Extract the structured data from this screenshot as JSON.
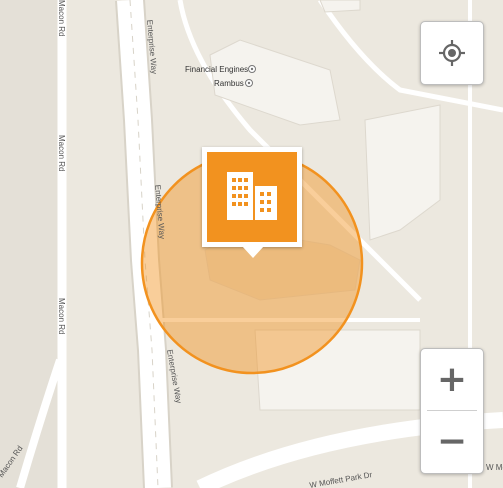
{
  "map": {
    "poi": [
      {
        "label": "Financial Engines"
      },
      {
        "label": "Rambus"
      }
    ],
    "roads": [
      {
        "label": "Enterprise Way"
      },
      {
        "label": "Enterprise Way"
      },
      {
        "label": "Enterprise Way"
      },
      {
        "label": "Macon Rd"
      },
      {
        "label": "Macon Rd"
      },
      {
        "label": "Macon Rd"
      },
      {
        "label": "Macon Rd"
      },
      {
        "label": "W Moffett Park Dr"
      },
      {
        "label": "W Mo"
      }
    ],
    "colors": {
      "background": "#ece8df",
      "highway": "#ffffff",
      "building": "#f5f3ee",
      "accent": "#f2921f",
      "radius_fill": "#f2921f"
    }
  },
  "controls": {
    "locate_icon": "crosshair-icon",
    "zoom_in_label": "+",
    "zoom_out_label": "−"
  },
  "marker": {
    "icon": "office-building-icon"
  }
}
